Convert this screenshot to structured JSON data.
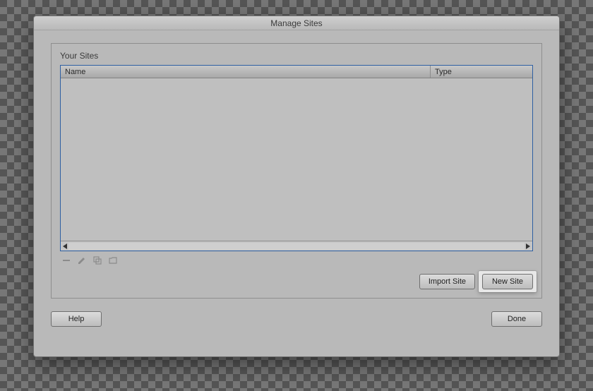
{
  "window": {
    "title": "Manage Sites"
  },
  "panel": {
    "title": "Your Sites",
    "columns": {
      "name": "Name",
      "type": "Type"
    }
  },
  "buttons": {
    "import_site": "Import Site",
    "new_site": "New Site",
    "help": "Help",
    "done": "Done"
  }
}
